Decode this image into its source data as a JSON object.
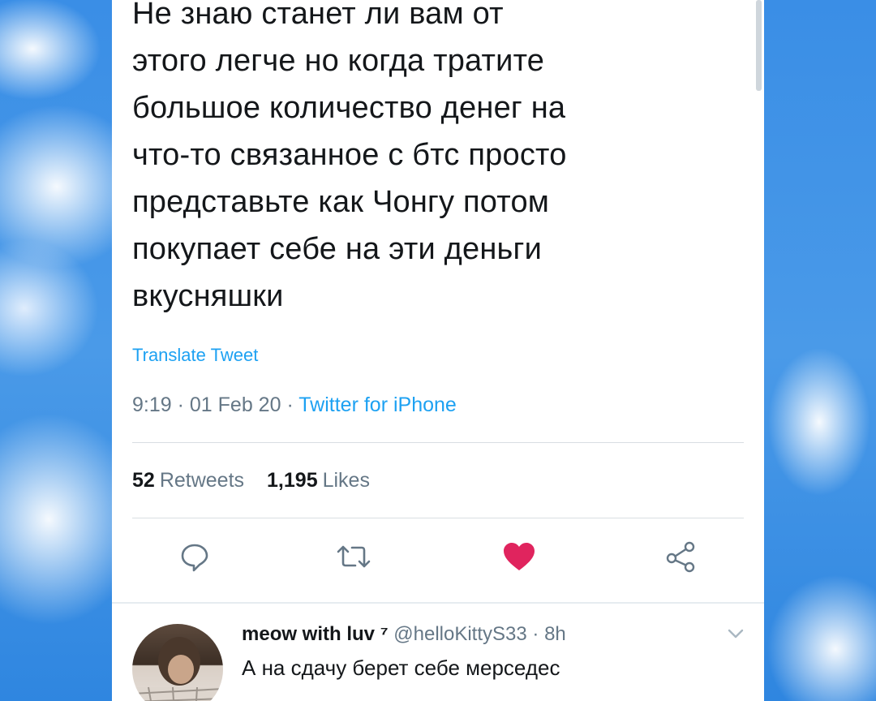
{
  "tweet": {
    "text": "Не знаю станет ли вам от\nэтого легче но когда тратите\nбольшое количество денег на\nчто-то связанное с бтс просто\nпредставьте как Чонгу потом\nпокупает себе на эти деньги\nвкусняшки",
    "translate_label": "Translate Tweet",
    "time": "9:19",
    "date": "01 Feb 20",
    "client": "Twitter for iPhone",
    "separator": "·",
    "retweets_count": "52",
    "retweets_label": "Retweets",
    "likes_count": "1,195",
    "likes_label": "Likes"
  },
  "actions": {
    "reply_icon": "comment-icon",
    "retweet_icon": "retweet-icon",
    "like_icon": "heart-filled-icon",
    "share_icon": "share-icon",
    "like_color": "#e0245e",
    "icon_color": "#657786"
  },
  "reply": {
    "name": "meow with luv",
    "badge": "⁷",
    "handle": "@helloKittyS33",
    "time": "8h",
    "text": "А на сдачу берет себе мерседес"
  },
  "colors": {
    "link": "#1da1f2",
    "secondary": "#657786",
    "primary_text": "#14171a"
  }
}
